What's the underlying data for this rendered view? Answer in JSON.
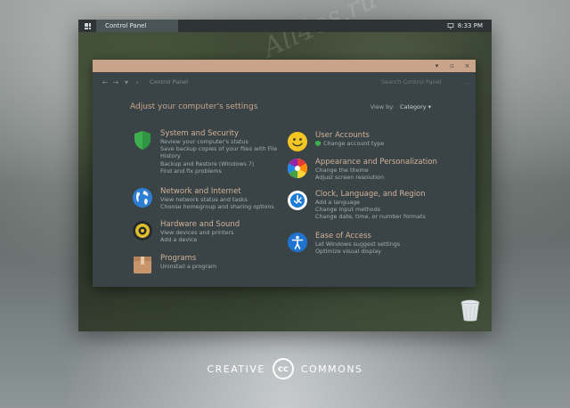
{
  "taskbar": {
    "task_label": "Control Panel",
    "clock": "8:33 PM"
  },
  "watermark": "All4os.ru",
  "window": {
    "breadcrumb": "Control Panel",
    "search_placeholder": "Search Control Panel",
    "more": "..."
  },
  "main": {
    "heading": "Adjust your computer's settings",
    "view_by_label": "View by:",
    "view_by_value": "Category",
    "left_items": [
      {
        "title": "System and Security",
        "links": [
          "Review your computer's status",
          "Save backup copies of your files with File",
          "History",
          "Backup and Restore (Windows 7)",
          "Find and fix problems"
        ]
      },
      {
        "title": "Network and Internet",
        "links": [
          "View network status and tasks",
          "Choose homegroup and sharing options"
        ]
      },
      {
        "title": "Hardware and Sound",
        "links": [
          "View devices and printers",
          "Add a device"
        ]
      },
      {
        "title": "Programs",
        "links": [
          "Uninstall a program"
        ]
      }
    ],
    "right_items": [
      {
        "title": "User Accounts",
        "links": [
          "Change account type"
        ]
      },
      {
        "title": "Appearance and Personalization",
        "links": [
          "Change the theme",
          "Adjust screen resolution"
        ]
      },
      {
        "title": "Clock, Language, and Region",
        "links": [
          "Add a language",
          "Change input methods",
          "Change date, time, or number formats"
        ]
      },
      {
        "title": "Ease of Access",
        "links": [
          "Let Windows suggest settings",
          "Optimize visual display"
        ]
      }
    ]
  },
  "footer": {
    "left": "CREATIVE",
    "logo": "cc",
    "right": "COMMONS"
  }
}
